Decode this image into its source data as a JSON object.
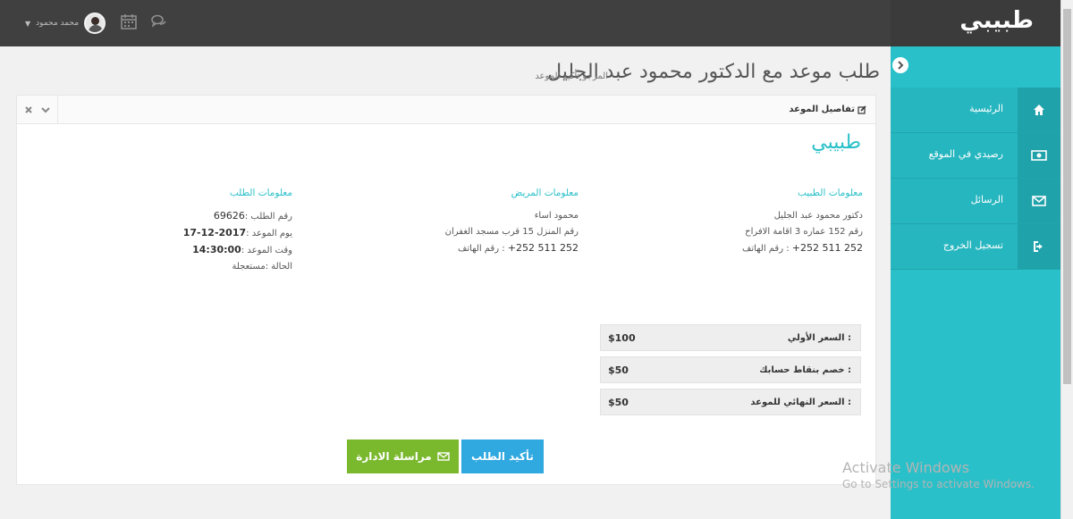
{
  "brand": "طبيبي",
  "topbar": {
    "user_name": "محمد محمود"
  },
  "sidebar": {
    "items": [
      {
        "label": "الرئيسية",
        "icon": "home-icon"
      },
      {
        "label": "رصيدي في الموقع",
        "icon": "money-icon"
      },
      {
        "label": "الرسائل",
        "icon": "envelope-icon"
      },
      {
        "label": "تسجيل الخروج",
        "icon": "sign-out-icon"
      }
    ]
  },
  "page": {
    "title": "طلب موعد مع الدكتور محمود عبد الجليل",
    "subtitle": "المرجو تأكيد الموعد"
  },
  "panel": {
    "title": "تفاصيل الموعد",
    "logo": "طبيبي",
    "doctor": {
      "heading": "معلومات الطبيب",
      "name": "دكتور محمود عبد الجليل",
      "address": "رقم 152 عماره 3 اقامة الافراح",
      "phone_label": "رقم الهاتف :",
      "phone": "+252 511 252"
    },
    "patient": {
      "heading": "معلومات المريض",
      "name": "محمود اساء",
      "address": "رقم المنزل 15 قرب مسجد الغفران",
      "phone_label": "رقم الهاتف :",
      "phone": "+252 511 252"
    },
    "order": {
      "heading": "معلومات الطلب",
      "id_label": "رقم الطلب :",
      "id": "69626",
      "date_label": "يوم الموعد :",
      "date": "2017-12-17",
      "time_label": "وقت الموعد :",
      "time": "14:30:00",
      "status_label": "الحالة :",
      "status": "مستعجلة"
    },
    "prices": [
      {
        "label": "السعر الأولي :",
        "value": "$100"
      },
      {
        "label": "خصم بنقاط حسابك :",
        "value": "$50"
      },
      {
        "label": "السعر النهائي للموعد :",
        "value": "$50"
      }
    ],
    "buttons": {
      "confirm": "تأكيد الطلب",
      "message": "مراسلة الادارة"
    }
  },
  "watermark": {
    "line1": "Activate Windows",
    "line2": "Go to Settings to activate Windows."
  },
  "colors": {
    "accent": "#2ac0c9",
    "confirm": "#30a8e0",
    "message": "#7ab82e"
  }
}
